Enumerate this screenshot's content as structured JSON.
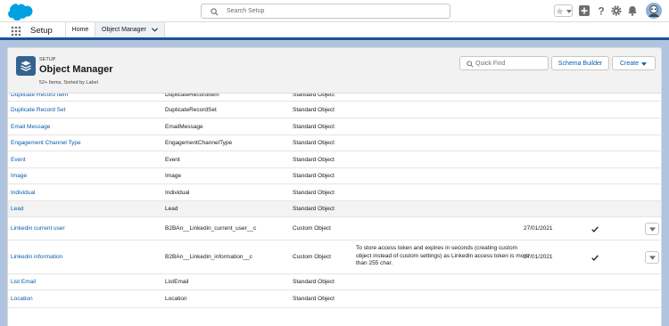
{
  "header": {
    "search_placeholder": "Search Setup"
  },
  "nav": {
    "app_name": "Setup",
    "home_label": "Home",
    "tab_label": "Object Manager"
  },
  "object_manager": {
    "breadcrumb": "SETUP",
    "title": "Object Manager",
    "subtitle": "52+ Items, Sorted by Label",
    "quick_find_placeholder": "Quick Find",
    "schema_builder_label": "Schema Builder",
    "create_label": "Create"
  },
  "rows": [
    {
      "label": "Duplicate Record Item",
      "api": "DuplicateRecordItem",
      "type": "Standard Object",
      "desc": "",
      "date": "",
      "deployed": false,
      "menu": false
    },
    {
      "label": "Duplicate Record Set",
      "api": "DuplicateRecordSet",
      "type": "Standard Object",
      "desc": "",
      "date": "",
      "deployed": false,
      "menu": false
    },
    {
      "label": "Email Message",
      "api": "EmailMessage",
      "type": "Standard Object",
      "desc": "",
      "date": "",
      "deployed": false,
      "menu": false
    },
    {
      "label": "Engagement Channel Type",
      "api": "EngagementChannelType",
      "type": "Standard Object",
      "desc": "",
      "date": "",
      "deployed": false,
      "menu": false
    },
    {
      "label": "Event",
      "api": "Event",
      "type": "Standard Object",
      "desc": "",
      "date": "",
      "deployed": false,
      "menu": false
    },
    {
      "label": "Image",
      "api": "Image",
      "type": "Standard Object",
      "desc": "",
      "date": "",
      "deployed": false,
      "menu": false
    },
    {
      "label": "Individual",
      "api": "Individual",
      "type": "Standard Object",
      "desc": "",
      "date": "",
      "deployed": false,
      "menu": false
    },
    {
      "label": "Lead",
      "api": "Lead",
      "type": "Standard Object",
      "desc": "",
      "date": "",
      "deployed": false,
      "menu": false
    },
    {
      "label": "Linkedin current user",
      "api": "B2BAn__Linkedin_current_user__c",
      "type": "Custom Object",
      "desc": "",
      "date": "27/01/2021",
      "deployed": true,
      "menu": true
    },
    {
      "label": "Linkedin information",
      "api": "B2BAn__Linkedin_information__c",
      "type": "Custom Object",
      "desc": "To store access token and expires in seconds (creating custom object instead of custom settings) as Linkedin access token is more than 255 char.",
      "date": "27/01/2021",
      "deployed": true,
      "menu": true
    },
    {
      "label": "List Email",
      "api": "ListEmail",
      "type": "Standard Object",
      "desc": "",
      "date": "",
      "deployed": false,
      "menu": false
    },
    {
      "label": "Location",
      "api": "Location",
      "type": "Standard Object",
      "desc": "",
      "date": "",
      "deployed": false,
      "menu": false
    }
  ],
  "colors": {
    "brand": "#00a1e0",
    "link": "#0b5cab",
    "nav_underline": "#1b5297",
    "object_icon": "#34638f"
  }
}
